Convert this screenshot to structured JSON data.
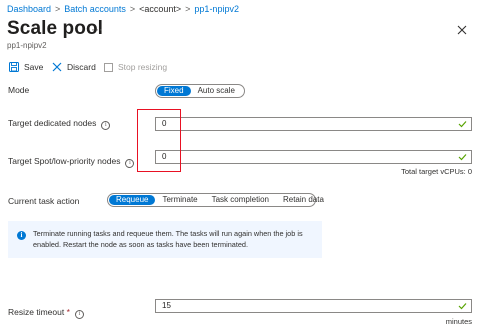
{
  "breadcrumb": {
    "items": [
      "Dashboard",
      "Batch accounts",
      "<account>",
      "pp1-npipv2"
    ],
    "separator": ">"
  },
  "header": {
    "title": "Scale pool",
    "subtitle": "pp1-npipv2",
    "more": "···"
  },
  "toolbar": {
    "save_label": "Save",
    "discard_label": "Discard",
    "stop_resizing_label": "Stop resizing"
  },
  "form": {
    "mode": {
      "label": "Mode",
      "options": [
        "Fixed",
        "Auto scale"
      ],
      "selected": "Fixed"
    },
    "target_dedicated": {
      "label": "Target dedicated nodes",
      "value": "0"
    },
    "target_spot": {
      "label": "Target Spot/low-priority nodes",
      "value": "0"
    },
    "total_vcpus": "Total target vCPUs: 0",
    "current_task_action": {
      "label": "Current task action",
      "options": [
        "Requeue",
        "Terminate",
        "Task completion",
        "Retain data"
      ],
      "selected": "Requeue"
    },
    "info_message": "Terminate running tasks and requeue them. The tasks will run again when the job is enabled. Restart the node as soon as tasks have been terminated.",
    "resize_timeout": {
      "label": "Resize timeout",
      "required_mark": "*",
      "value": "15",
      "unit": "minutes"
    }
  },
  "colors": {
    "accent": "#0078d4",
    "valid_check": "#57a300",
    "highlight_box": "#e81123",
    "info_background": "#f0f6ff"
  }
}
